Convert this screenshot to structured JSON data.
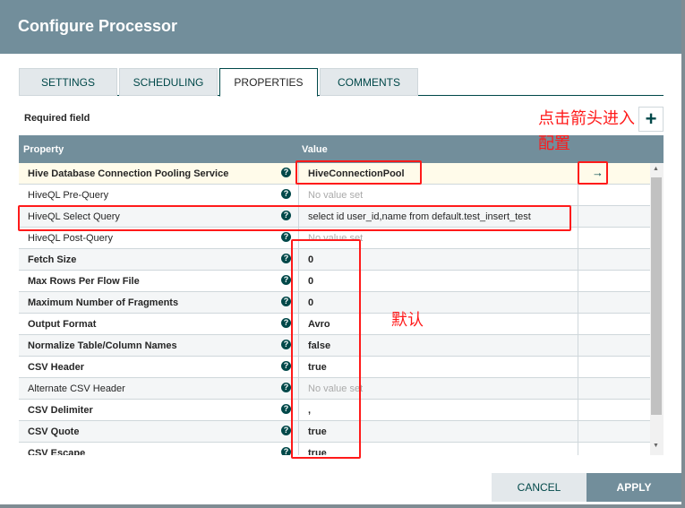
{
  "title": "Configure Processor",
  "tabs": [
    "SETTINGS",
    "SCHEDULING",
    "PROPERTIES",
    "COMMENTS"
  ],
  "active_tab": "PROPERTIES",
  "required_label": "Required field",
  "add_label": "+",
  "columns": {
    "property": "Property",
    "value": "Value"
  },
  "rows": [
    {
      "name": "Hive Database Connection Pooling Service",
      "value": "HiveConnectionPool",
      "required": true,
      "empty": false
    },
    {
      "name": "HiveQL Pre-Query",
      "value": "No value set",
      "required": false,
      "empty": true
    },
    {
      "name": "HiveQL Select Query",
      "value": "select id user_id,name from default.test_insert_test",
      "required": false,
      "empty": false
    },
    {
      "name": "HiveQL Post-Query",
      "value": "No value set",
      "required": false,
      "empty": true
    },
    {
      "name": "Fetch Size",
      "value": "0",
      "required": true,
      "empty": false
    },
    {
      "name": "Max Rows Per Flow File",
      "value": "0",
      "required": true,
      "empty": false
    },
    {
      "name": "Maximum Number of Fragments",
      "value": "0",
      "required": true,
      "empty": false
    },
    {
      "name": "Output Format",
      "value": "Avro",
      "required": true,
      "empty": false
    },
    {
      "name": "Normalize Table/Column Names",
      "value": "false",
      "required": true,
      "empty": false
    },
    {
      "name": "CSV Header",
      "value": "true",
      "required": true,
      "empty": false
    },
    {
      "name": "Alternate CSV Header",
      "value": "No value set",
      "required": false,
      "empty": true
    },
    {
      "name": "CSV Delimiter",
      "value": ",",
      "required": true,
      "empty": false
    },
    {
      "name": "CSV Quote",
      "value": "true",
      "required": true,
      "empty": false
    },
    {
      "name": "CSV Escape",
      "value": "true",
      "required": true,
      "empty": false
    }
  ],
  "goto_icon": "arrow-right-icon",
  "help_icon": "question-circle-icon",
  "buttons": {
    "cancel": "CANCEL",
    "apply": "APPLY"
  },
  "annotations": {
    "arrow_note": "点击箭头进入配置",
    "default_note": "默认"
  },
  "colors": {
    "header": "#728e9b",
    "accent": "#004849",
    "annotation": "#ff1a1a"
  }
}
